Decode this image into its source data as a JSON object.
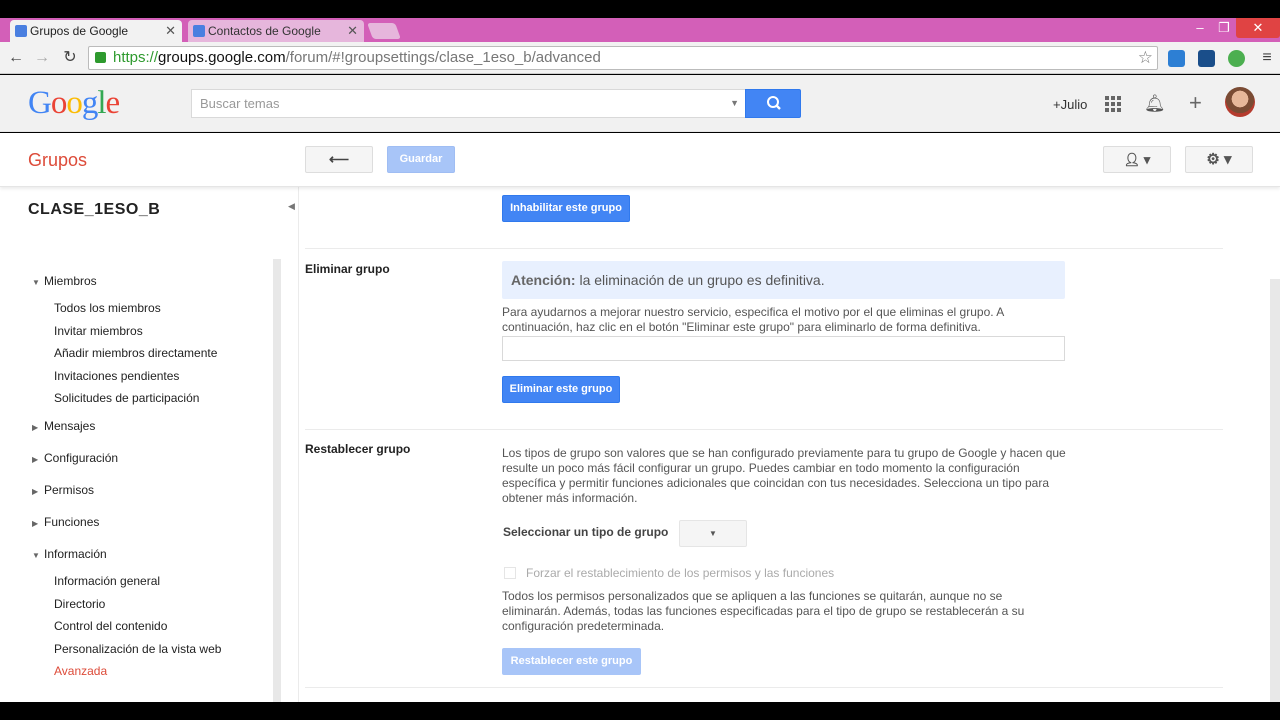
{
  "browser": {
    "tabs": [
      {
        "label": "Grupos de Google",
        "active": true
      },
      {
        "label": "Contactos de Google",
        "active": false
      }
    ],
    "url": {
      "scheme": "https://",
      "host": "groups.google.com",
      "path": "/forum/#!groupsettings/clase_1eso_b/advanced"
    },
    "window_controls": {
      "minimize": "‒",
      "maximize": "❐",
      "close": "✕"
    }
  },
  "header": {
    "logo": "Google",
    "search_placeholder": "Buscar temas",
    "user_link": "+Julio"
  },
  "appbar": {
    "title": "Grupos",
    "back_label": "⟵",
    "save_label": "Guardar"
  },
  "sidebar": {
    "group_name": "CLASE_1ESO_B",
    "members": {
      "label": "Miembros",
      "items": [
        "Todos los miembros",
        "Invitar miembros",
        "Añadir miembros directamente",
        "Invitaciones pendientes",
        "Solicitudes de participación"
      ]
    },
    "collapsed": [
      "Mensajes",
      "Configuración",
      "Permisos",
      "Funciones"
    ],
    "info": {
      "label": "Información",
      "items": [
        "Información general",
        "Directorio",
        "Control del contenido",
        "Personalización de la vista web",
        "Avanzada"
      ]
    }
  },
  "main": {
    "disable_button": "Inhabilitar este grupo",
    "delete_section": {
      "label": "Eliminar grupo",
      "notice_strong": "Atención:",
      "notice_text": " la eliminación de un grupo es definitiva.",
      "description": "Para ayudarnos a mejorar nuestro servicio, especifica el motivo por el que eliminas el grupo. A continuación, haz clic en el botón \"Eliminar este grupo\" para eliminarlo de forma definitiva.",
      "button": "Eliminar este grupo"
    },
    "reset_section": {
      "label": "Restablecer grupo",
      "description": "Los tipos de grupo son valores que se han configurado previamente para tu grupo de Google y hacen que resulte un poco más fácil configurar un grupo. Puedes cambiar en todo momento la configuración específica y permitir funciones adicionales que coincidan con tus necesidades. Selecciona un tipo para obtener más información.",
      "select_label": "Seleccionar un tipo de grupo",
      "checkbox_label": "Forzar el restablecimiento de los permisos y las funciones",
      "note": "Todos los permisos personalizados que se apliquen a las funciones se quitarán, aunque no se eliminarán. Además, todas las funciones especificadas para el tipo de grupo se restablecerán a su configuración predeterminada.",
      "button": "Restablecer este grupo"
    }
  },
  "colors": {
    "google_blue": "#4285f4",
    "groups_red": "#dd4b39",
    "titlebar": "#d35fb8"
  }
}
